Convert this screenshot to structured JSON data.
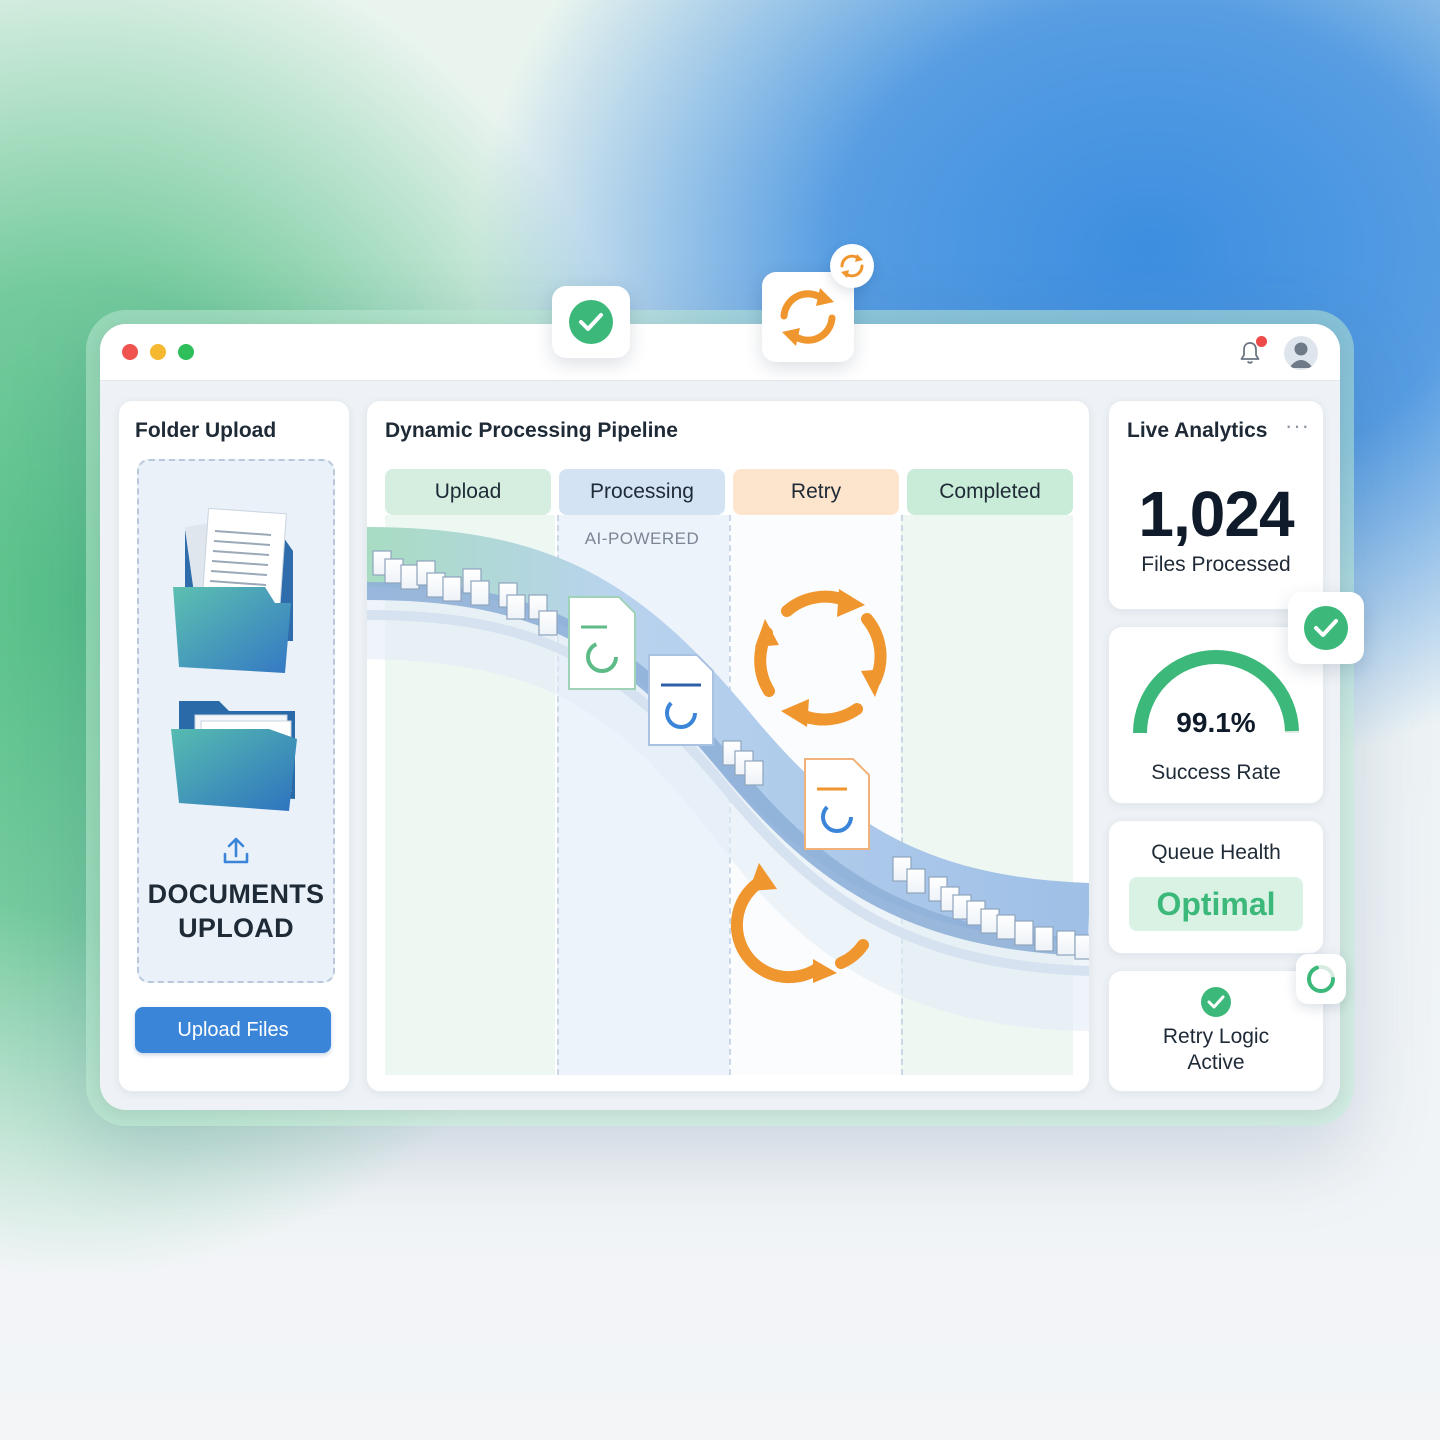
{
  "window": {
    "controls": [
      "close",
      "minimize",
      "maximize"
    ],
    "icons": [
      "bell-icon",
      "user-avatar-icon"
    ]
  },
  "upload_panel": {
    "title": "Folder Upload",
    "drop_label_line1": "DOCUMENTS",
    "drop_label_line2": "UPLOAD",
    "button": "Upload Files"
  },
  "pipeline": {
    "title": "Dynamic Processing Pipeline",
    "stages": [
      {
        "label": "Upload",
        "color": "#d5eee0"
      },
      {
        "label": "Processing",
        "color": "#d3e3f4",
        "sub": "AI-POWERED"
      },
      {
        "label": "Retry",
        "color": "#fde4cc"
      },
      {
        "label": "Completed",
        "color": "#c9ecd8"
      }
    ]
  },
  "analytics": {
    "title": "Live Analytics",
    "files_processed_value": "1,024",
    "files_processed_label": "Files Processed",
    "success_rate_value": "99.1%",
    "success_rate_fraction": 0.991,
    "success_rate_label": "Success Rate",
    "queue_health_label": "Queue Health",
    "queue_health_value": "Optimal",
    "retry_label_line1": "Retry Logic",
    "retry_label_line2": "Active"
  },
  "colors": {
    "accent_blue": "#3b85d9",
    "accent_green": "#3cb97a",
    "accent_orange": "#f0962e",
    "dot_red": "#ef5350",
    "dot_yellow": "#f5b82e",
    "dot_green": "#2fbf5a"
  }
}
